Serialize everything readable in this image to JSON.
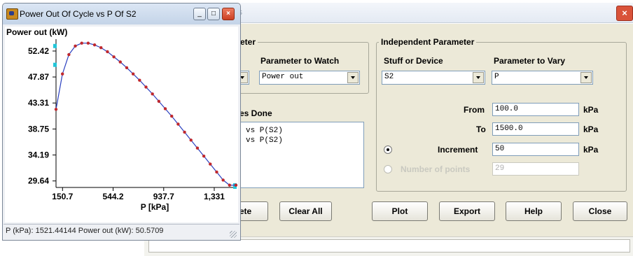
{
  "dialog": {
    "title_partial": "s",
    "close_glyph": "×",
    "dependent": {
      "group_label_partial": "eter",
      "param_to_watch_label": "Parameter to Watch",
      "param_to_watch_value": "Power out"
    },
    "cases_done": {
      "label_partial": "es Done",
      "items": [
        "vs P(S2)",
        "vs P(S2)"
      ]
    },
    "independent": {
      "group_label": "Independent Parameter",
      "stuff_label": "Stuff or Device",
      "stuff_value": "S2",
      "param_to_vary_label": "Parameter to Vary",
      "param_to_vary_value": "P",
      "from_label": "From",
      "from_value": "100.0",
      "from_unit": "kPa",
      "to_label": "To",
      "to_value": "1500.0",
      "to_unit": "kPa",
      "increment_label": "Increment",
      "increment_value": "50",
      "increment_unit": "kPa",
      "points_label": "Number of points",
      "points_value": "29"
    },
    "buttons": {
      "delete_partial": "ete",
      "clear_all": "Clear All",
      "plot": "Plot",
      "export": "Export",
      "help": "Help",
      "close": "Close"
    }
  },
  "plot_window": {
    "title": "Power Out Of Cycle vs P Of S2",
    "status": "P (kPa): 1521.44144  Power out (kW): 50.5709",
    "minimize_glyph": "_",
    "maximize_glyph": "□",
    "close_glyph": "×"
  },
  "chart_data": {
    "type": "line",
    "title": "",
    "ylabel": "Power out (kW)",
    "xlabel": "P [kPa]",
    "xlim": [
      100,
      1500
    ],
    "ylim": [
      28.5,
      54.5
    ],
    "x_ticks": [
      "150.7",
      "544.2",
      "937.7",
      "1,331"
    ],
    "x_tick_values": [
      150.7,
      544.2,
      937.7,
      1331
    ],
    "y_ticks": [
      "52.42",
      "47.87",
      "43.31",
      "38.75",
      "34.19",
      "29.64"
    ],
    "y_tick_values": [
      52.42,
      47.87,
      43.31,
      38.75,
      34.19,
      29.64
    ],
    "line_color": "#2a3fbf",
    "point_color": "#c0282d",
    "x": [
      100,
      150,
      200,
      250,
      300,
      350,
      400,
      450,
      500,
      550,
      600,
      650,
      700,
      750,
      800,
      850,
      900,
      950,
      1000,
      1050,
      1100,
      1150,
      1200,
      1250,
      1300,
      1350,
      1400,
      1450,
      1500
    ],
    "y": [
      42.2,
      48.4,
      51.8,
      53.3,
      53.8,
      53.8,
      53.5,
      53.0,
      52.3,
      51.4,
      50.5,
      49.5,
      48.4,
      47.3,
      46.1,
      44.9,
      43.6,
      42.3,
      41.0,
      39.6,
      38.2,
      36.8,
      35.4,
      34.0,
      32.6,
      31.2,
      29.8,
      28.9,
      28.9
    ]
  }
}
